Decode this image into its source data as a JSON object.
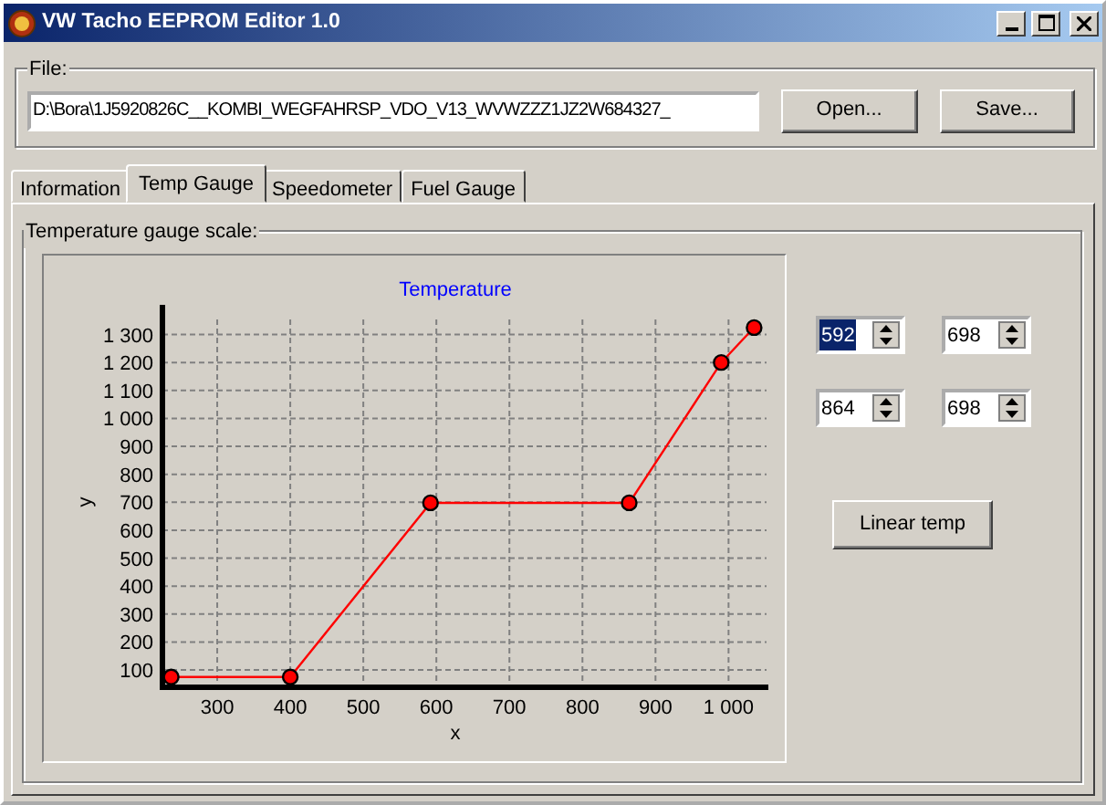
{
  "window": {
    "title": "VW Tacho EEPROM Editor 1.0"
  },
  "file_group": {
    "label": "File:",
    "path": "D:\\Bora\\1J5920826C__KOMBI_WEGFAHRSP_VDO_V13_WVWZZZ1JZ2W684327_",
    "buttons": [
      "Open...",
      "Save..."
    ]
  },
  "tabs": [
    {
      "label": "Information",
      "selected": false
    },
    {
      "label": "Temp Gauge",
      "selected": true
    },
    {
      "label": "Speedometer",
      "selected": false
    },
    {
      "label": "Fuel Gauge",
      "selected": false
    }
  ],
  "scale_group": {
    "label": "Temperature gauge scale:",
    "chart_data": {
      "type": "line",
      "title": "Temperature",
      "xlabel": "x",
      "ylabel": "y",
      "x": [
        237,
        400,
        592,
        864,
        990,
        1035
      ],
      "series": [
        {
          "color": "#ff0000",
          "marker": true,
          "values": [
            75,
            75,
            698,
            698,
            1200,
            1325
          ]
        }
      ],
      "grid": true,
      "xlim": [
        225,
        1052
      ],
      "ylim": [
        48,
        1354
      ],
      "xticks": [
        300,
        400,
        500,
        600,
        700,
        800,
        900,
        {
          "value": 1000,
          "label": "1 000"
        }
      ],
      "yticks": [
        100,
        200,
        300,
        400,
        500,
        600,
        700,
        800,
        900,
        {
          "value": 1000,
          "label": "1 000"
        },
        {
          "value": 1100,
          "label": "1 100"
        },
        {
          "value": 1200,
          "label": "1 200"
        },
        {
          "value": 1300,
          "label": "1 300"
        }
      ]
    },
    "spin_boxes": [
      {
        "value": "592",
        "selected": true
      },
      {
        "value": "698",
        "selected": false
      },
      {
        "value": "864",
        "selected": false
      },
      {
        "value": "698",
        "selected": false
      }
    ],
    "button": "Linear temp"
  }
}
